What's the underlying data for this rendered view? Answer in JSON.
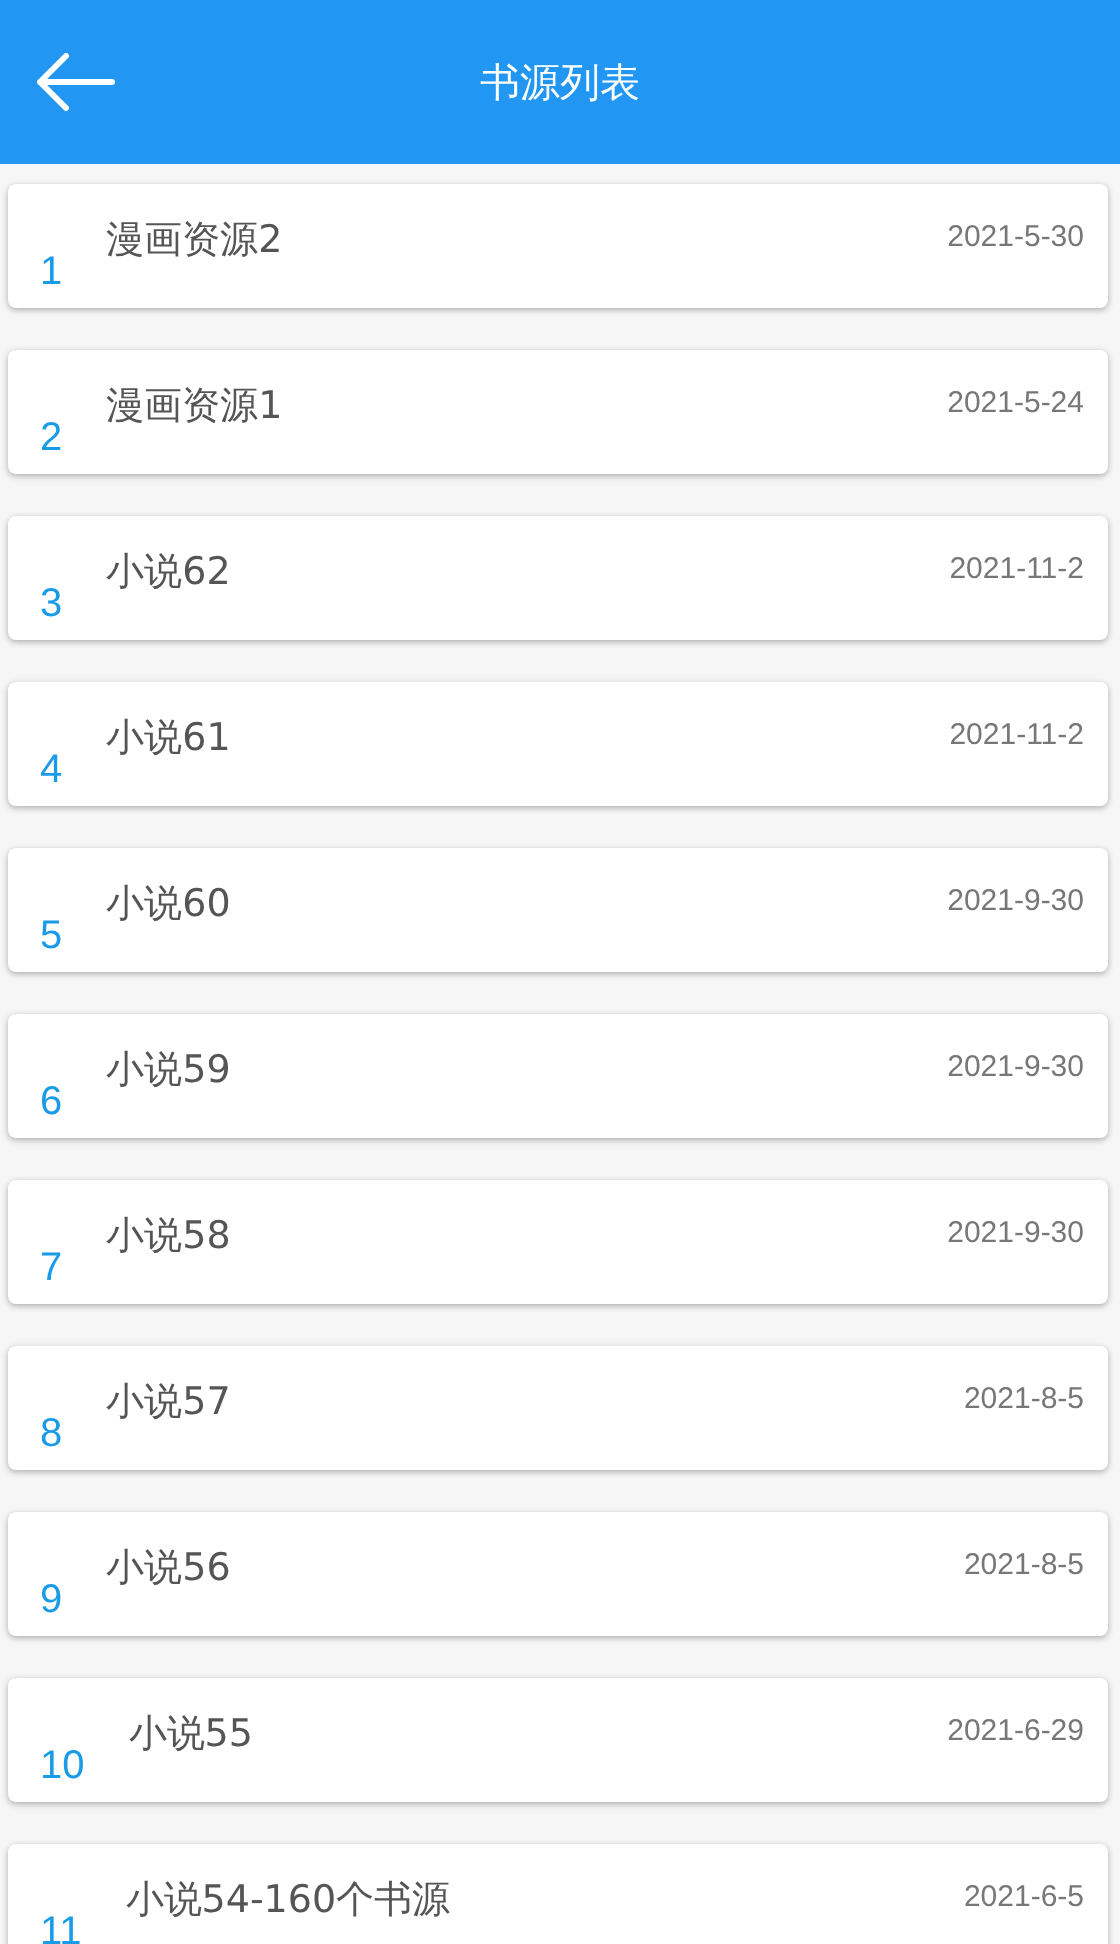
{
  "header": {
    "title": "书源列表"
  },
  "sources": [
    {
      "index": "1",
      "name": "漫画资源2",
      "date": "2021-5-30"
    },
    {
      "index": "2",
      "name": "漫画资源1",
      "date": "2021-5-24"
    },
    {
      "index": "3",
      "name": "小说62",
      "date": "2021-11-2"
    },
    {
      "index": "4",
      "name": "小说61",
      "date": "2021-11-2"
    },
    {
      "index": "5",
      "name": "小说60",
      "date": "2021-9-30"
    },
    {
      "index": "6",
      "name": "小说59",
      "date": "2021-9-30"
    },
    {
      "index": "7",
      "name": "小说58",
      "date": "2021-9-30"
    },
    {
      "index": "8",
      "name": "小说57",
      "date": "2021-8-5"
    },
    {
      "index": "9",
      "name": "小说56",
      "date": "2021-8-5"
    },
    {
      "index": "10",
      "name": "小说55",
      "date": "2021-6-29"
    },
    {
      "index": "11",
      "name": "小说54-160个书源",
      "date": "2021-6-5"
    }
  ]
}
